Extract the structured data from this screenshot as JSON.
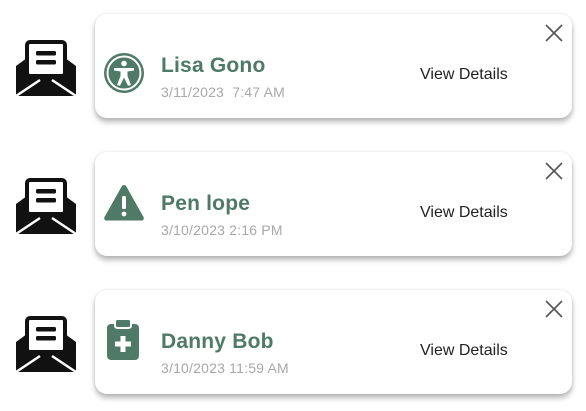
{
  "colors": {
    "accent": "#4e7a67",
    "timestamp": "#a8a8a8",
    "text": "#222222",
    "icon_dark": "#111111"
  },
  "notifications": [
    {
      "name": "Lisa Gono",
      "timestamp": "3/11/2023  7:47 AM",
      "action_label": "View Details",
      "type_icon": "accessibility-icon",
      "status_icon": "open-envelope-icon",
      "close_icon": "close-icon"
    },
    {
      "name": "Pen lope",
      "timestamp": "3/10/2023 2:16 PM",
      "action_label": "View Details",
      "type_icon": "warning-icon",
      "status_icon": "open-envelope-icon",
      "close_icon": "close-icon"
    },
    {
      "name": "Danny Bob",
      "timestamp": "3/10/2023 11:59 AM",
      "action_label": "View Details",
      "type_icon": "medical-clipboard-icon",
      "status_icon": "open-envelope-icon",
      "close_icon": "close-icon"
    }
  ]
}
